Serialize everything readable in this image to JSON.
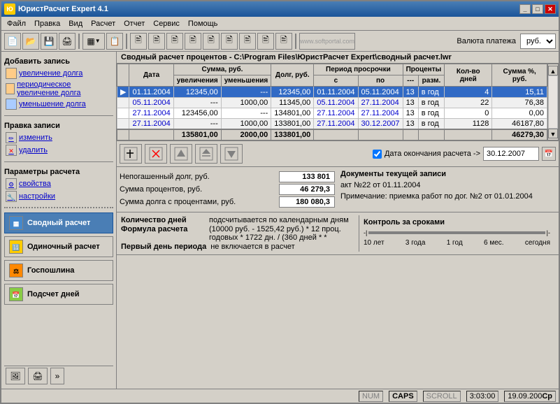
{
  "window": {
    "title": "ЮристРасчет Expert 4.1"
  },
  "menubar": {
    "items": [
      "Файл",
      "Правка",
      "Вид",
      "Расчет",
      "Отчет",
      "Сервис",
      "Помощь"
    ]
  },
  "toolbar": {
    "currency_label": "Валюта платежа",
    "currency_value": "руб."
  },
  "left_panel": {
    "add_record": "Добавить запись",
    "items_add": [
      {
        "label": "увеличение долга",
        "icon": "increase-icon"
      },
      {
        "label": "периодическое увеличение долга",
        "icon": "periodic-icon"
      },
      {
        "label": "уменьшение долга",
        "icon": "decrease-icon"
      }
    ],
    "edit_record": "Правка записи",
    "items_edit": [
      {
        "label": "изменить",
        "icon": "edit-icon"
      },
      {
        "label": "удалить",
        "icon": "delete-icon"
      }
    ],
    "calc_params": "Параметры расчета",
    "items_calc": [
      {
        "label": "свойства",
        "icon": "props-icon"
      },
      {
        "label": "настройки",
        "icon": "settings-icon"
      }
    ],
    "nav_buttons": [
      {
        "label": "Сводный расчет",
        "active": true,
        "icon": "table-icon"
      },
      {
        "label": "Одиночный расчет",
        "active": false,
        "icon": "calc-icon"
      },
      {
        "label": "Госпошлина",
        "active": false,
        "icon": "fee-icon"
      },
      {
        "label": "Подсчет дней",
        "active": false,
        "icon": "days-icon"
      }
    ]
  },
  "content_header": "Сводный расчет процентов - C:\\Program Files\\ЮристРасчет Expert\\сводный расчет.lwr",
  "table": {
    "headers": {
      "date": "Дата",
      "sum_rub": "Сумма, руб.",
      "sum_increase": "увеличения",
      "sum_decrease": "уменьшения",
      "debt_rub": "Долг, руб.",
      "period_from": "с",
      "period_to": "по",
      "percent_year": "---",
      "percent_razm": "разм.",
      "days": "Кол-во дней",
      "sum_percent": "Сумма %, руб."
    },
    "rows": [
      {
        "selected": true,
        "date": "01.11.2004",
        "increase": "12345,00",
        "decrease": "---",
        "debt": "12345,00",
        "period_from": "01.11.2004",
        "period_to": "05.11.2004",
        "percent": "13",
        "period_type": "в год",
        "days": "4",
        "sum_pct": "15,11"
      },
      {
        "selected": false,
        "date": "05.11.2004",
        "increase": "---",
        "decrease": "1000,00",
        "debt": "11345,00",
        "period_from": "05.11.2004",
        "period_to": "27.11.2004",
        "percent": "13",
        "period_type": "в год",
        "days": "22",
        "sum_pct": "76,38"
      },
      {
        "selected": false,
        "date": "27.11.2004",
        "increase": "123456,00",
        "decrease": "---",
        "debt": "134801,00",
        "period_from": "27.11.2004",
        "period_to": "27.11.2004",
        "percent": "13",
        "period_type": "в год",
        "days": "0",
        "sum_pct": "0,00"
      },
      {
        "selected": false,
        "date": "27.11.2004",
        "increase": "---",
        "decrease": "1000,00",
        "debt": "133801,00",
        "period_from": "27.11.2004",
        "period_to": "30.12.2007",
        "percent": "13",
        "period_type": "в год",
        "days": "1128",
        "sum_pct": "46187,80"
      }
    ],
    "footer": {
      "increase": "135801,00",
      "decrease": "2000,00",
      "debt": "133801,00",
      "sum_pct": "46279,30"
    }
  },
  "action_toolbar": {
    "btn1": "⊞",
    "btn2": "✕",
    "btn3": "↑",
    "btn4": "↑",
    "btn5": "↓",
    "date_check_label": "Дата окончания расчета ->",
    "date_value": "30.12.2007"
  },
  "summary": {
    "debt_label": "Непогашенный долг, руб.",
    "debt_value": "133 801",
    "percent_label": "Сумма процентов, руб.",
    "percent_value": "46 279,3",
    "total_label": "Сумма долга с процентами, руб.",
    "total_value": "180 080,3",
    "docs_title": "Документы текущей записи",
    "doc1": "акт №22 от 01.11.2004",
    "doc2": "Примечание: приемка работ по дог. №2 от 01.01.2004"
  },
  "status_rows": [
    {
      "label": "Количество дней",
      "value": "подсчитывается по календарным дням"
    },
    {
      "label": "Формула расчета",
      "value": "(10000 руб. - 1525,42 руб.) * 12 проц. годовых * 1722 дн. / (360 дней * *"
    },
    {
      "label": "Первый день периода",
      "value": "не включается в расчет"
    }
  ],
  "deadline": {
    "title": "Контроль за сроками",
    "segments": [
      "10 лет",
      "3 года",
      "1 год",
      "6 мес.",
      "сегодня"
    ]
  },
  "statusbar": {
    "num": "NUM",
    "caps": "CAPS",
    "scroll": "SCROLL",
    "time": "3:03:00",
    "date": "19.09.200",
    "indicator": "Ср"
  }
}
